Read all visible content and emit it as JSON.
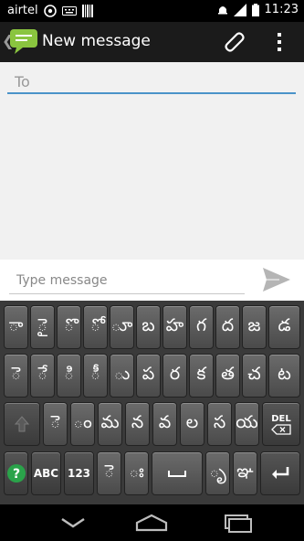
{
  "status_bar": {
    "carrier": "airtel",
    "time": "11:23"
  },
  "action_bar": {
    "title": "New message"
  },
  "recipient": {
    "placeholder": "To",
    "value": ""
  },
  "compose": {
    "placeholder": "Type message",
    "value": ""
  },
  "keyboard": {
    "row1": [
      "ా",
      "ై",
      "ొ",
      "ో",
      "ూ",
      "బ",
      "హ",
      "గ",
      "ద",
      "జ",
      "డ"
    ],
    "row2": [
      "ె",
      "ే",
      "ి",
      "ీ",
      "ు",
      "ప",
      "ర",
      "క",
      "త",
      "చ",
      "ట"
    ],
    "row3": [
      "ె",
      "ం",
      "మ",
      "న",
      "వ",
      "ల",
      "స",
      "య"
    ],
    "row3_del_label": "DEL",
    "row4": {
      "help_label": "?",
      "abc_label": "ABC",
      "num_label": "123",
      "k1": "ె",
      "k2": "ః",
      "k3": "ృ",
      "k4": "ఞ"
    }
  },
  "colors": {
    "accent": "#4a93c9",
    "app_icon": "#8ac53f"
  }
}
